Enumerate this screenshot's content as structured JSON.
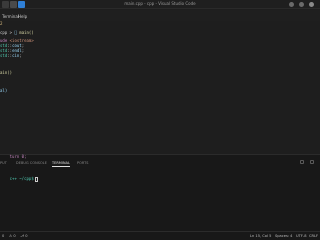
{
  "window": {
    "title": "main.cpp - cpp - Visual Studio Code"
  },
  "menu": {
    "items": [
      "Terminal",
      "Help"
    ]
  },
  "breadcrumb": {
    "text": "2"
  },
  "editor": {
    "lines": [
      {
        "parts": [
          [
            "cpp",
            "tok-punc"
          ],
          [
            " > ",
            "tok-punc"
          ],
          [
            "⎕",
            "tok-id"
          ],
          [
            " main()",
            "tok-fn"
          ]
        ]
      },
      {
        "parts": [
          [
            "ude ",
            "tok-kw"
          ],
          [
            "<iostream>",
            "tok-str"
          ]
        ]
      },
      {
        "parts": [
          [
            "std",
            "tok-ns"
          ],
          [
            "::",
            "tok-punc"
          ],
          [
            "cout",
            "tok-id"
          ],
          [
            ";",
            "tok-punc"
          ]
        ]
      },
      {
        "parts": [
          [
            "std",
            "tok-ns"
          ],
          [
            "::",
            "tok-punc"
          ],
          [
            "endl",
            "tok-id"
          ],
          [
            ";",
            "tok-punc"
          ]
        ]
      },
      {
        "parts": [
          [
            "std",
            "tok-ns"
          ],
          [
            "::",
            "tok-punc"
          ],
          [
            "cin",
            "tok-id"
          ],
          [
            ";",
            "tok-punc"
          ]
        ]
      },
      {
        "parts": [
          [
            "ain()",
            "tok-fn"
          ]
        ]
      },
      {
        "parts": [
          [
            "al)",
            "tok-id"
          ]
        ]
      }
    ]
  },
  "panel": {
    "tabs": [
      "PUT",
      "DEBUG CONSOLE",
      "TERMINAL",
      "PORTS"
    ],
    "active_tab": "TERMINAL",
    "terminal_lines": [
      "turn 0;",
      "c++ ~/cpp$"
    ]
  },
  "statusbar": {
    "left": [
      "0",
      "⚠ 0",
      "⎇ 0"
    ],
    "right": [
      "Ln 15, Col 5",
      "Spaces: 4",
      "UTF-8",
      "CRLF"
    ]
  }
}
